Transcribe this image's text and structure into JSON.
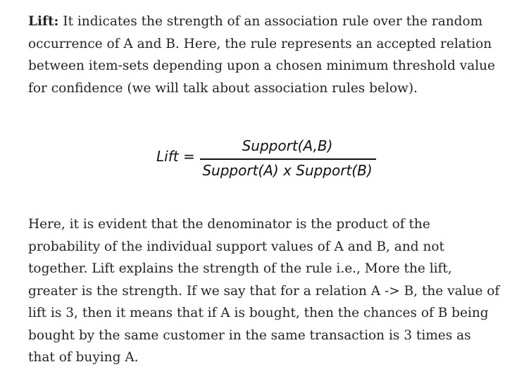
{
  "paragraph1": {
    "term": "Lift:",
    "text": " It indicates the strength of an association rule over the random occurrence of A and B. Here, the rule represents an accepted relation between item-sets depending upon a chosen minimum threshold value for confidence (we will talk about association rules below)."
  },
  "formula": {
    "lhs": "Lift =",
    "numerator": "Support(A,B)",
    "denominator": "Support(A) x Support(B)"
  },
  "paragraph2": {
    "text": "Here, it is evident that the denominator is the product of the probability of the individual support values of A and B, and not together. Lift explains the strength of the rule i.e., More the lift, greater is the strength. If we say that for a relation A -> B, the value of lift is 3, then it means that if A is bought, then the chances of B being bought by the same customer in the same transaction is 3 times as that of buying A."
  }
}
